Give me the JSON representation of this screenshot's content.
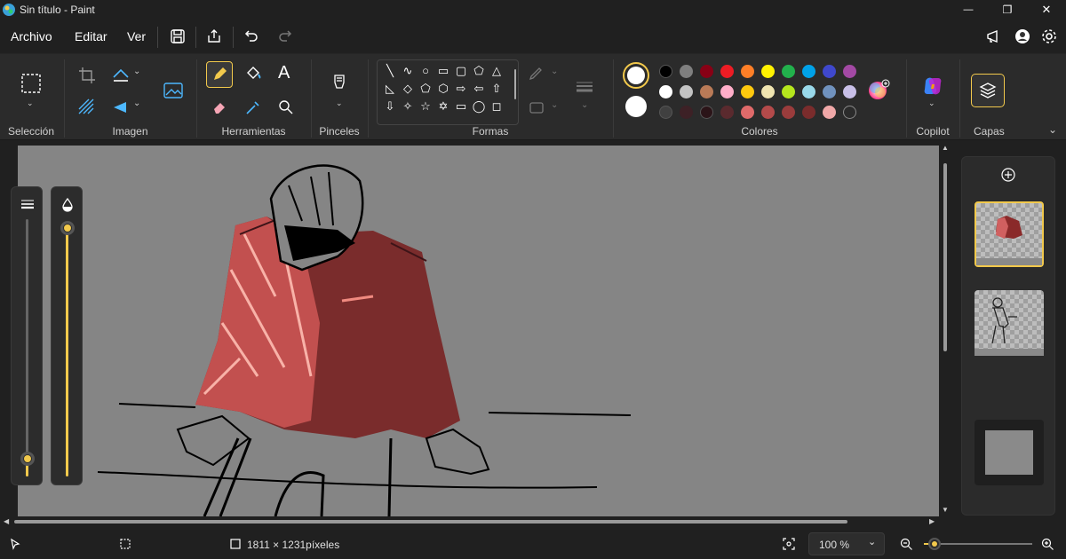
{
  "window": {
    "title": "Sin título - Paint",
    "minimize_glyph": "—",
    "maximize_glyph": "❐",
    "close_glyph": "✕"
  },
  "menu": {
    "items": [
      "Archivo",
      "Editar",
      "Ver"
    ],
    "icons": [
      "save-icon",
      "share-icon",
      "undo-icon",
      "redo-icon"
    ],
    "right_icons": [
      "feedback-icon",
      "account-icon",
      "settings-icon"
    ]
  },
  "ribbon": {
    "groups": {
      "seleccion": "Selección",
      "imagen": "Imagen",
      "herramientas": "Herramientas",
      "pinceles": "Pinceles",
      "formas": "Formas",
      "colores": "Colores",
      "copilot": "Copilot",
      "capas": "Capas"
    },
    "text_tool_glyph": "A",
    "shapes": [
      "╲",
      "∿",
      "○",
      "▭",
      "▢",
      "⬠",
      "△",
      "◺",
      "◇",
      "⬠",
      "⬡",
      "⇨",
      "⇦",
      "⇧",
      "⇩",
      "✧",
      "☆",
      "✡",
      "▭",
      "◯",
      "◻"
    ],
    "colors": {
      "primary": "#ffffff",
      "secondary": "#ffffff",
      "row1": [
        "#000000",
        "#7f7f7f",
        "#880015",
        "#ed1c24",
        "#ff7f27",
        "#fff200",
        "#22b14c",
        "#00a2e8",
        "#3f48cc",
        "#a349a4"
      ],
      "row2": [
        "#ffffff",
        "#c3c3c3",
        "#b97a57",
        "#ffaec9",
        "#ffc90e",
        "#efe4b0",
        "#b5e61d",
        "#99d9ea",
        "#7092be",
        "#c8bfe7"
      ],
      "row3": [
        "#404040",
        "#3d2126",
        "#2b1418",
        "#5a2a2e",
        "#e06a6a",
        "#b44a4a",
        "#9a3c3c",
        "#7a2c2c",
        "#f0a8a8",
        "transparent"
      ]
    }
  },
  "statusbar": {
    "dimensions": "1811 × 1231píxeles",
    "zoom": "100 %",
    "zoom_level": 0.1
  },
  "layers": {
    "count": 3,
    "selected": 0
  }
}
